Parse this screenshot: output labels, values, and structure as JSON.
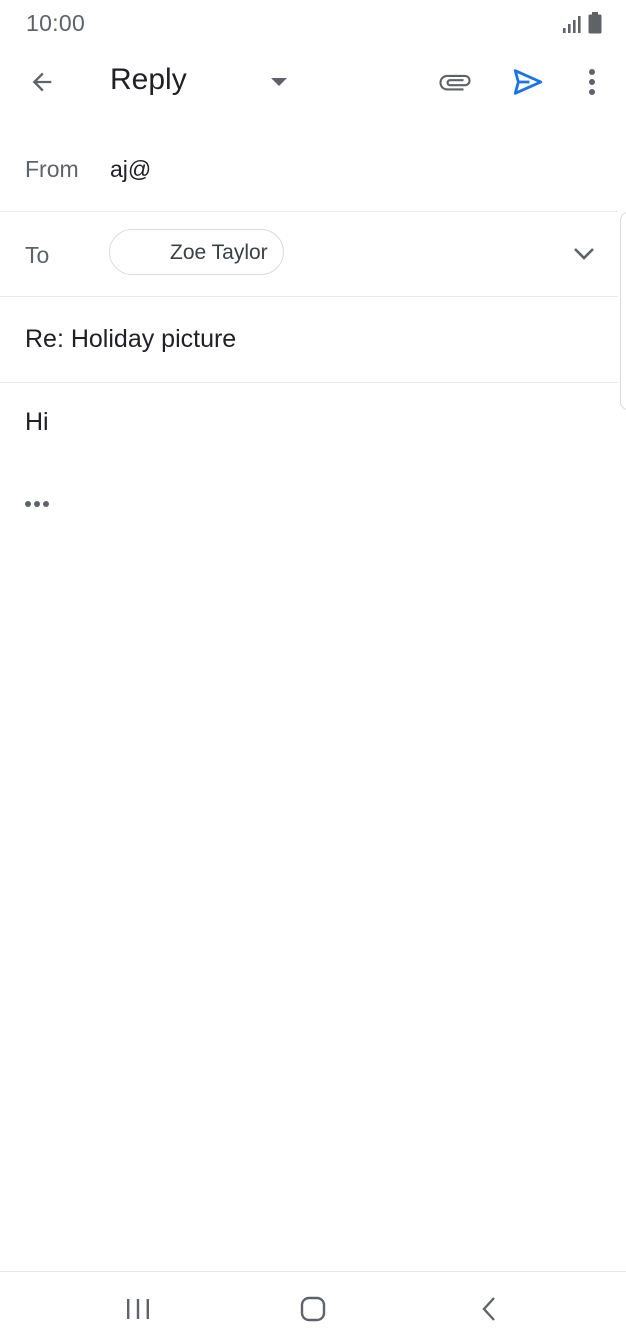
{
  "status_bar": {
    "time": "10:00",
    "icons": [
      "signal-icon",
      "battery-icon"
    ]
  },
  "app_bar": {
    "title": "Reply",
    "icons": [
      "back-arrow-icon",
      "dropdown-arrow-icon",
      "attachment-icon",
      "send-icon",
      "more-vert-icon"
    ],
    "accent_color": "#1a73e8"
  },
  "compose": {
    "from_label": "From",
    "from_value": "aj@",
    "to_label": "To",
    "to_recipients": [
      "Zoe Taylor"
    ],
    "subject": "Re: Holiday picture",
    "body": "Hi"
  },
  "nav_bar": {
    "icons": [
      "recents-icon",
      "home-icon",
      "nav-back-icon"
    ]
  }
}
